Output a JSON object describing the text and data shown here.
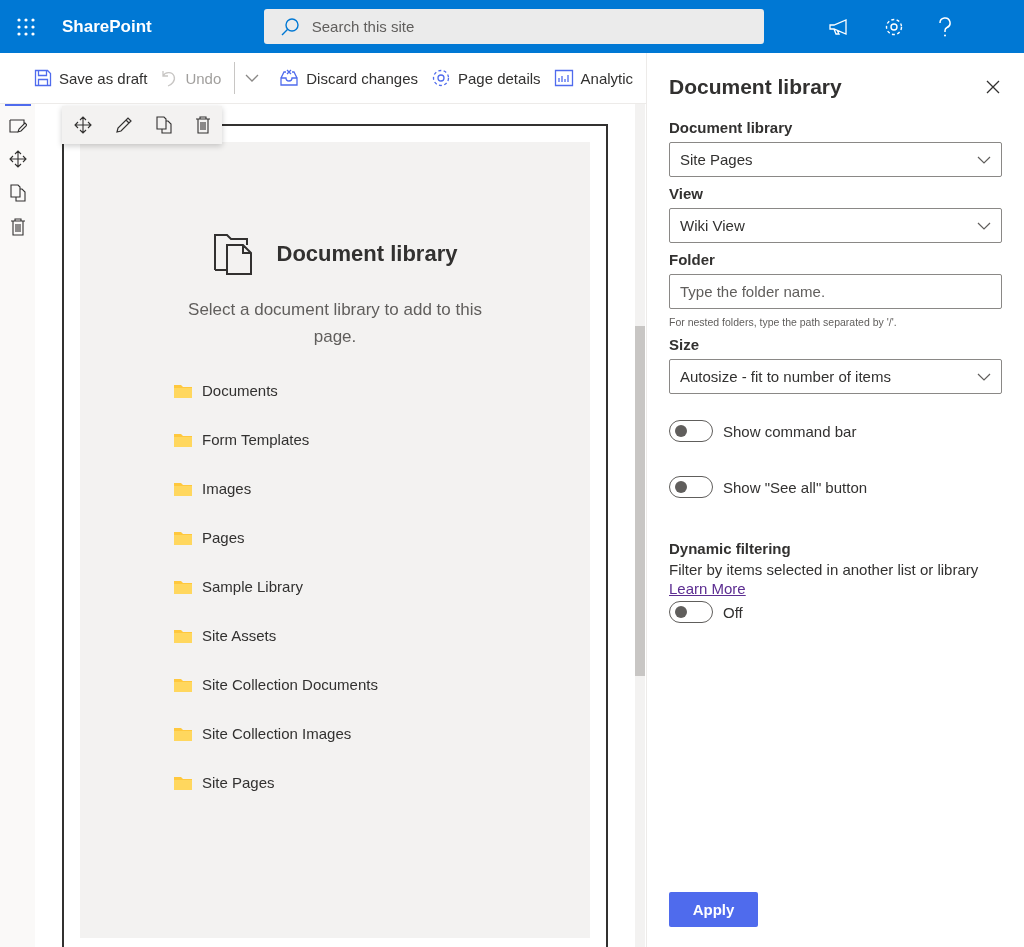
{
  "app": {
    "name": "SharePoint"
  },
  "search": {
    "placeholder": "Search this site"
  },
  "toolbar": [
    {
      "kind": "save",
      "label": "Save as draft",
      "disabled": false
    },
    {
      "kind": "undo",
      "label": "Undo",
      "disabled": true
    },
    {
      "kind": "chevron",
      "disabled": false
    },
    {
      "kind": "discard",
      "label": "Discard changes",
      "disabled": false
    },
    {
      "kind": "details",
      "label": "Page details",
      "disabled": false
    },
    {
      "kind": "analytics",
      "label": "Analytic",
      "disabled": false
    }
  ],
  "webpart": {
    "title": "Document library",
    "description": "Select a document library to add to this page.",
    "folders": [
      "Documents",
      "Form Templates",
      "Images",
      "Pages",
      "Sample Library",
      "Site Assets",
      "Site Collection Documents",
      "Site Collection Images",
      "Site Pages"
    ]
  },
  "panel": {
    "title": "Document library",
    "fields": [
      {
        "kind": "dropdown",
        "label": "Document library",
        "value": "Site Pages"
      },
      {
        "kind": "dropdown",
        "label": "View",
        "value": "Wiki View"
      },
      {
        "kind": "text",
        "label": "Folder",
        "placeholder": "Type the folder name.",
        "hint": "For nested folders, type the path separated by '/'."
      },
      {
        "kind": "dropdown",
        "label": "Size",
        "value": "Autosize - fit to number of items"
      }
    ],
    "toggles": [
      {
        "label": "Show command bar",
        "on": false
      },
      {
        "label": "Show \"See all\" button",
        "on": false
      }
    ],
    "filtering": {
      "heading": "Dynamic filtering",
      "description": "Filter by items selected in another list or library",
      "link": "Learn More",
      "toggle": {
        "label": "Off",
        "on": false
      }
    },
    "apply": "Apply"
  }
}
